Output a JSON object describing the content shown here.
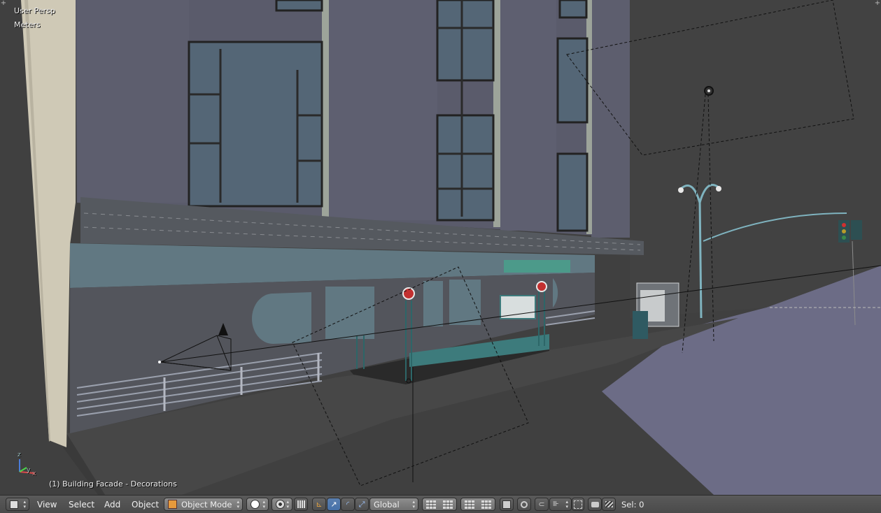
{
  "viewport": {
    "view_name": "User Persp",
    "units": "Meters",
    "selection_info": "(1) Building Facade - Decorations",
    "axis_labels": {
      "z": "z",
      "y": "y",
      "x": "x"
    }
  },
  "header": {
    "menus": {
      "view": "View",
      "select": "Select",
      "add": "Add",
      "object": "Object"
    },
    "mode": "Object Mode",
    "orientation": "Global",
    "status": "Sel: 0"
  },
  "colors": {
    "accent": "#5680c2",
    "viewport_bg": "#434343",
    "header_bg": "#4d4d4d"
  }
}
